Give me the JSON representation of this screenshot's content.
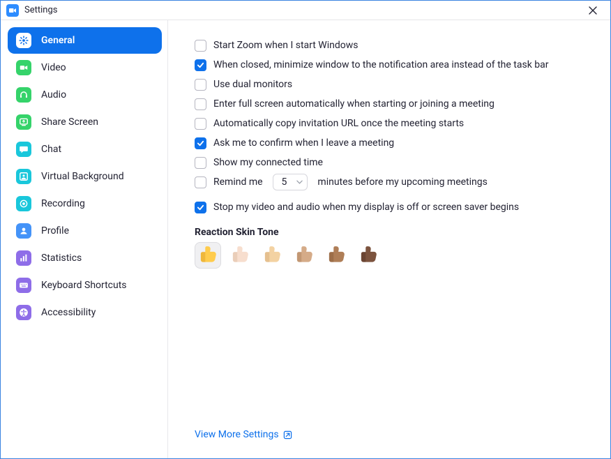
{
  "title": "Settings",
  "sidebar": {
    "items": [
      {
        "id": "general",
        "label": "General",
        "icon": "gear-icon",
        "bg": "#ffffff",
        "fg": "#0E71EB",
        "active": true
      },
      {
        "id": "video",
        "label": "Video",
        "icon": "video-icon",
        "bg": "#35D36A",
        "fg": "#ffffff",
        "active": false
      },
      {
        "id": "audio",
        "label": "Audio",
        "icon": "headphones-icon",
        "bg": "#35D36A",
        "fg": "#ffffff",
        "active": false
      },
      {
        "id": "share-screen",
        "label": "Share Screen",
        "icon": "share-screen-icon",
        "bg": "#35D36A",
        "fg": "#ffffff",
        "active": false
      },
      {
        "id": "chat",
        "label": "Chat",
        "icon": "chat-icon",
        "bg": "#19C7DB",
        "fg": "#ffffff",
        "active": false
      },
      {
        "id": "virtual-background",
        "label": "Virtual Background",
        "icon": "virtual-bg-icon",
        "bg": "#19C7DB",
        "fg": "#ffffff",
        "active": false
      },
      {
        "id": "recording",
        "label": "Recording",
        "icon": "recording-icon",
        "bg": "#19C7DB",
        "fg": "#ffffff",
        "active": false
      },
      {
        "id": "profile",
        "label": "Profile",
        "icon": "profile-icon",
        "bg": "#4493F8",
        "fg": "#ffffff",
        "active": false
      },
      {
        "id": "statistics",
        "label": "Statistics",
        "icon": "statistics-icon",
        "bg": "#8E6DE8",
        "fg": "#ffffff",
        "active": false
      },
      {
        "id": "keyboard-shortcuts",
        "label": "Keyboard Shortcuts",
        "icon": "keyboard-icon",
        "bg": "#8E6DE8",
        "fg": "#ffffff",
        "active": false
      },
      {
        "id": "accessibility",
        "label": "Accessibility",
        "icon": "accessibility-icon",
        "bg": "#8E6DE8",
        "fg": "#ffffff",
        "active": false
      }
    ]
  },
  "options": [
    {
      "id": "start-with-windows",
      "label": "Start Zoom when I start Windows",
      "checked": false
    },
    {
      "id": "minimize-to-tray",
      "label": "When closed, minimize window to the notification area instead of the task bar",
      "checked": true
    },
    {
      "id": "dual-monitors",
      "label": "Use dual monitors",
      "checked": false
    },
    {
      "id": "fullscreen-on-join",
      "label": "Enter full screen automatically when starting or joining a meeting",
      "checked": false
    },
    {
      "id": "copy-invite-url",
      "label": "Automatically copy invitation URL once the meeting starts",
      "checked": false
    },
    {
      "id": "confirm-leave",
      "label": "Ask me to confirm when I leave a meeting",
      "checked": true
    },
    {
      "id": "show-connected-time",
      "label": "Show my connected time",
      "checked": false
    }
  ],
  "reminder": {
    "checked": false,
    "pre_label": "Remind me",
    "value": "5",
    "post_label": "minutes before my upcoming meetings"
  },
  "stop_av": {
    "checked": true,
    "label": "Stop my video and audio when my display is off or screen saver begins"
  },
  "skin_tone": {
    "title": "Reaction Skin Tone",
    "selected": 0,
    "tones": [
      {
        "fill": "#FFCC4D",
        "shade": "#E2A62D"
      },
      {
        "fill": "#F7DECE",
        "shade": "#E0C1A8"
      },
      {
        "fill": "#F3D2A2",
        "shade": "#D9B07F"
      },
      {
        "fill": "#D5AB88",
        "shade": "#B28663"
      },
      {
        "fill": "#AF7E57",
        "shade": "#8E613E"
      },
      {
        "fill": "#7C533E",
        "shade": "#5C3A29"
      }
    ]
  },
  "view_more": {
    "label": "View More Settings"
  }
}
